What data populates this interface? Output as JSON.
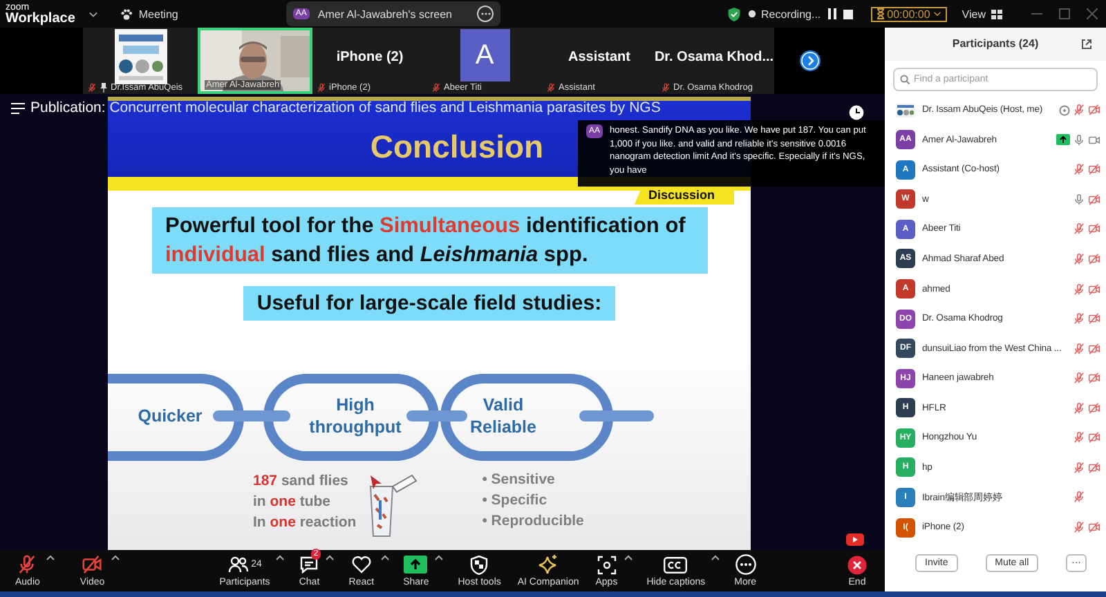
{
  "top_bar": {
    "logo": "zoom",
    "product": "Workplace",
    "meeting": "Meeting",
    "share_badge": "AA",
    "share_label": "Amer Al-Jawabreh's screen",
    "recording": "Recording...",
    "timer": "00:00:00",
    "view": "View"
  },
  "gallery": [
    {
      "kind": "picture",
      "label": "Dr.Issam AbuQeis",
      "muted": true,
      "pinned": true,
      "selected": false
    },
    {
      "kind": "video",
      "label": "Amer Al-Jawabreh",
      "muted": false,
      "pinned": false,
      "selected": true
    },
    {
      "kind": "name",
      "title": "iPhone (2)",
      "label": "iPhone (2)",
      "muted": true,
      "pinned": false,
      "selected": false
    },
    {
      "kind": "avatar",
      "title": "A",
      "color": "#5a5fc4",
      "label": "Abeer Titi",
      "muted": true,
      "pinned": false,
      "selected": false
    },
    {
      "kind": "name",
      "title": "Assistant",
      "label": "Assistant",
      "muted": true,
      "pinned": false,
      "selected": false
    },
    {
      "kind": "name",
      "title": "Dr. Osama Khod...",
      "label": "Dr. Osama Khodrog",
      "muted": true,
      "pinned": false,
      "selected": false
    }
  ],
  "share": {
    "prefix": "Publication:",
    "title": "Concurrent molecular characterization of sand flies and Leishmania parasites by NGS",
    "slide": {
      "heading": "Conclusion",
      "tab": "Discussion",
      "statement": "Powerful tool for the **Simultaneous** identification of **individual** sand flies and *Leishmania* spp.",
      "subheading": "Useful for large-scale field studies:",
      "links": [
        [
          "Quicker"
        ],
        [
          "High",
          "throughput"
        ],
        [
          "Valid",
          "Reliable"
        ]
      ],
      "facts": [
        "**187** sand flies",
        "in **one** tube",
        "In **one** reaction"
      ],
      "bullets": [
        "• Sensitive",
        "• Specific",
        "• Reproducible"
      ]
    },
    "caption": {
      "badge": "AA",
      "text": "honest. Sandify DNA as you like. We have put 187. You can put 1,000 if you like. and valid and reliable it's sensitive 0.0016 nanogram detection limit And it's specific. Especially if it's NGS, you have"
    }
  },
  "toolbar": [
    {
      "kind": "audio",
      "label": "Audio",
      "off": true,
      "caret": true
    },
    {
      "kind": "video",
      "label": "Video",
      "off": true,
      "caret": true
    },
    {
      "kind": "participants",
      "label": "Participants",
      "count": "24",
      "caret": true
    },
    {
      "kind": "chat",
      "label": "Chat",
      "badge": "2",
      "caret": true
    },
    {
      "kind": "react",
      "label": "React",
      "caret": true
    },
    {
      "kind": "share",
      "label": "Share",
      "caret": true
    },
    {
      "kind": "host",
      "label": "Host tools",
      "caret": false
    },
    {
      "kind": "ai",
      "label": "AI Companion",
      "caret": false
    },
    {
      "kind": "apps",
      "label": "Apps",
      "caret": true
    },
    {
      "kind": "captions",
      "label": "Hide captions",
      "caret": true
    },
    {
      "kind": "more",
      "label": "More",
      "caret": false
    },
    {
      "kind": "end",
      "label": "End",
      "caret": false
    }
  ],
  "participants": {
    "title": "Participants (24)",
    "search": {
      "placeholder": "Find a participant"
    },
    "rows": [
      {
        "name": "Dr. Issam AbuQeis (Host, me)",
        "icons": [
          {
            "kind": "host"
          },
          {
            "kind": "mic",
            "on": false
          },
          {
            "kind": "camera",
            "on": false
          }
        ]
      },
      {
        "avatar": {
          "kind": "initials",
          "text": "AA",
          "color": "#7b3fa6"
        },
        "name": "Amer Al-Jawabreh",
        "icons": [
          {
            "kind": "sharing"
          },
          {
            "kind": "mic",
            "on": true
          },
          {
            "kind": "camera",
            "on": true
          }
        ]
      },
      {
        "avatar": {
          "kind": "initials",
          "text": "A",
          "color": "#1f77c0"
        },
        "name": "Assistant (Co-host)",
        "icons": [
          {
            "kind": "mic",
            "on": false
          },
          {
            "kind": "camera",
            "on": false
          }
        ]
      },
      {
        "avatar": {
          "kind": "initials",
          "text": "W",
          "color": "#c0392b"
        },
        "name": "w",
        "icons": [
          {
            "kind": "mic",
            "on": true
          },
          {
            "kind": "camera",
            "on": false
          }
        ]
      },
      {
        "avatar": {
          "kind": "initials",
          "text": "A",
          "color": "#5a5fc4"
        },
        "name": "Abeer Titi",
        "icons": [
          {
            "kind": "mic",
            "on": false
          },
          {
            "kind": "camera",
            "on": false
          }
        ]
      },
      {
        "avatar": {
          "kind": "initials",
          "text": "AS",
          "color": "#2c3e50"
        },
        "name": "Ahmad Sharaf Abed",
        "icons": [
          {
            "kind": "mic",
            "on": false
          },
          {
            "kind": "camera",
            "on": false
          }
        ]
      },
      {
        "avatar": {
          "kind": "initials",
          "text": "A",
          "color": "#c0392b"
        },
        "name": "ahmed",
        "icons": [
          {
            "kind": "mic",
            "on": false
          },
          {
            "kind": "camera",
            "on": false
          }
        ]
      },
      {
        "avatar": {
          "kind": "initials",
          "text": "DO",
          "color": "#8e44ad"
        },
        "name": "Dr. Osama Khodrog",
        "icons": [
          {
            "kind": "mic",
            "on": false
          },
          {
            "kind": "camera",
            "on": false
          }
        ]
      },
      {
        "avatar": {
          "kind": "initials",
          "text": "DF",
          "color": "#34495e"
        },
        "name": "dunsuiLiao from the West China ...",
        "icons": [
          {
            "kind": "mic",
            "on": false
          },
          {
            "kind": "camera",
            "on": false
          }
        ]
      },
      {
        "avatar": {
          "kind": "initials",
          "text": "HJ",
          "color": "#8e44ad"
        },
        "name": "Haneen jawabreh",
        "icons": [
          {
            "kind": "mic",
            "on": false
          },
          {
            "kind": "camera",
            "on": false
          }
        ]
      },
      {
        "avatar": {
          "kind": "initials",
          "text": "H",
          "color": "#2c3e50"
        },
        "name": "HFLR",
        "icons": [
          {
            "kind": "mic",
            "on": false
          },
          {
            "kind": "camera",
            "on": false
          }
        ]
      },
      {
        "avatar": {
          "kind": "initials",
          "text": "HY",
          "color": "#27ae60"
        },
        "name": "Hongzhou Yu",
        "icons": [
          {
            "kind": "mic",
            "on": false
          },
          {
            "kind": "camera",
            "on": false
          }
        ]
      },
      {
        "avatar": {
          "kind": "initials",
          "text": "H",
          "color": "#27ae60"
        },
        "name": "hp",
        "icons": [
          {
            "kind": "mic",
            "on": false
          },
          {
            "kind": "camera",
            "on": false
          }
        ]
      },
      {
        "avatar": {
          "kind": "initials",
          "text": "I",
          "color": "#2980b9"
        },
        "name": "Ibrain编辑部周婷婷",
        "icons": [
          {
            "kind": "mic",
            "on": false
          }
        ]
      },
      {
        "avatar": {
          "kind": "initials",
          "text": "I(",
          "color": "#d35400"
        },
        "name": "iPhone (2)",
        "icons": [
          {
            "kind": "mic",
            "on": false
          },
          {
            "kind": "camera",
            "on": false
          }
        ]
      }
    ],
    "buttons": [
      {
        "kind": "text",
        "label": "Invite"
      },
      {
        "kind": "text",
        "label": "Mute all"
      },
      {
        "kind": "more",
        "label": "···"
      }
    ]
  }
}
